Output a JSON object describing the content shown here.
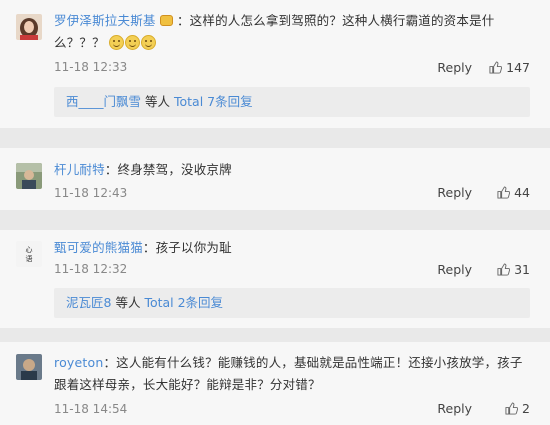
{
  "comments": [
    {
      "username": "罗伊泽斯拉夫斯基",
      "text_line1": "：这样的人怎么拿到驾照的？这种人横行霸道的资本是什",
      "text_line2": "么？？？",
      "time": "11-18 12:33",
      "reply_label": "Reply",
      "likes": "147",
      "sub": {
        "users": "西____门飘雪",
        "mid": "等人",
        "total": "Total 7条回复"
      }
    },
    {
      "username": "杆儿耐特",
      "text_line1": "：终身禁驾，没收京牌",
      "time": "11-18 12:43",
      "reply_label": "Reply",
      "likes": "44"
    },
    {
      "username": "甄可爱的熊猫猫",
      "text_line1": "：孩子以你为耻",
      "time": "11-18 12:32",
      "reply_label": "Reply",
      "likes": "31",
      "sub": {
        "users": "泥瓦匠8",
        "mid": "等人",
        "total": "Total 2条回复"
      }
    },
    {
      "username": "royeton",
      "text_line1": "：这人能有什么钱？能赚钱的人，基础就是品性端正！还接小孩放学，孩子",
      "text_line2": "跟着这样母亲，长大能好？能辩是非？分对错？",
      "time": "11-18 14:54",
      "reply_label": "Reply",
      "likes": "2"
    }
  ],
  "colors": {
    "link": "#4a8ad4",
    "text": "#333333",
    "meta": "#888888"
  },
  "icons": {
    "like": "thumbs-up-icon"
  }
}
